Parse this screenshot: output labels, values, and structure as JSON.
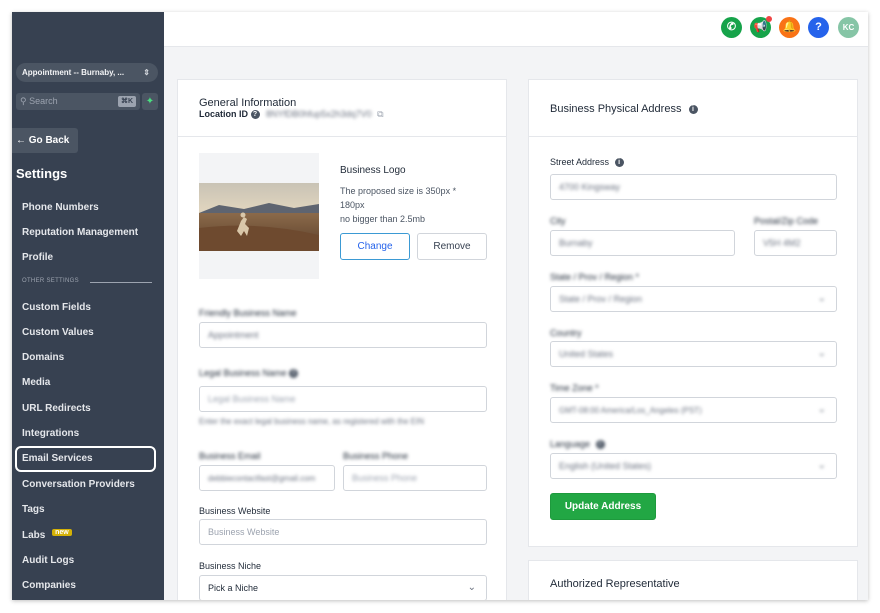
{
  "sidebar": {
    "location_select": "Appointment -- Burnaby, ...",
    "search_placeholder": "Search",
    "search_shortcut": "⌘K",
    "back_label": "Go Back",
    "settings_title": "Settings",
    "items": [
      {
        "label": "Phone Numbers"
      },
      {
        "label": "Reputation Management"
      },
      {
        "label": "Profile"
      }
    ],
    "other_settings_label": "OTHER SETTINGS",
    "other_items": [
      {
        "label": "Custom Fields"
      },
      {
        "label": "Custom Values"
      },
      {
        "label": "Domains"
      },
      {
        "label": "Media"
      },
      {
        "label": "URL Redirects"
      },
      {
        "label": "Integrations"
      },
      {
        "label": "Email Services"
      },
      {
        "label": "Conversation Providers"
      },
      {
        "label": "Tags"
      },
      {
        "label": "Labs"
      },
      {
        "label": "Audit Logs"
      },
      {
        "label": "Companies"
      }
    ],
    "labs_badge": "new",
    "highlighted_item": "Email Services"
  },
  "topbar": {
    "icons": [
      {
        "name": "phone-icon",
        "color": "#16a34a"
      },
      {
        "name": "megaphone-icon",
        "color": "#16a34a"
      },
      {
        "name": "bell-icon",
        "color": "#f97316"
      },
      {
        "name": "help-icon",
        "color": "#2563eb"
      }
    ],
    "avatar_initials": "KC",
    "avatar_color": "#86c5a6"
  },
  "general": {
    "title": "General Information",
    "location_id_label": "Location ID",
    "location_id_value": "8NYfDB0hfup5x2h3dq7V0",
    "logo_title": "Business Logo",
    "logo_help_1": "The proposed size is 350px *",
    "logo_help_2": "180px",
    "logo_help_3": "no bigger than 2.5mb",
    "change_label": "Change",
    "remove_label": "Remove",
    "friendly_name_label": "Friendly Business Name",
    "friendly_name_value": "Appointment",
    "legal_name_label": "Legal Business Name",
    "legal_name_placeholder": "Legal Business Name",
    "legal_name_help": "Enter the exact legal business name, as registered with the EIN",
    "email_label": "Business Email",
    "email_value": "debbiecontactfast@gmail.com",
    "phone_label": "Business Phone",
    "phone_placeholder": "Business Phone",
    "website_label": "Business Website",
    "website_placeholder": "Business Website",
    "niche_label": "Business Niche",
    "niche_value": "Pick a Niche"
  },
  "address": {
    "title": "Business Physical Address",
    "street_label": "Street Address",
    "street_value": "4700 Kingsway",
    "city_label": "City",
    "city_value": "Burnaby",
    "postal_label": "Postal/Zip Code",
    "postal_value": "V5H 4M2",
    "state_label": "State / Prov / Region *",
    "state_value": "State / Prov / Region",
    "country_label": "Country",
    "country_value": "United States",
    "timezone_label": "Time Zone *",
    "timezone_value": "GMT-08:00 America/Los_Angeles (PST)",
    "language_label": "Language",
    "language_value": "English (United States)",
    "update_label": "Update Address",
    "update_color": "#22a744"
  },
  "authorized": {
    "title": "Authorized Representative"
  }
}
